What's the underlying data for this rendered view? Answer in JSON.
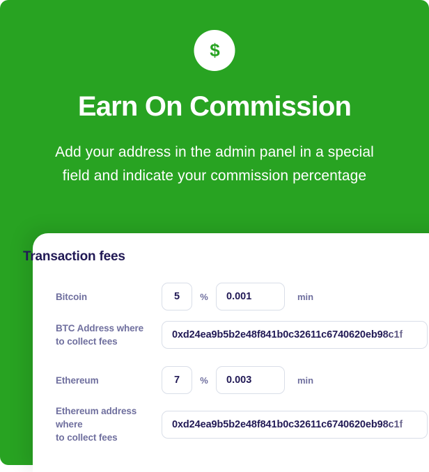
{
  "hero": {
    "icon": "dollar-circle-icon",
    "title": "Earn On Commission",
    "subtitle": "Add your address in the admin panel in a special field and indicate your commission percentage",
    "background_color": "#28A322",
    "text_color": "#FFFFFF"
  },
  "card": {
    "title": "Transaction fees",
    "title_color": "#211955",
    "label_color": "#6F6F9E",
    "border_color": "#D9DEE8",
    "fees": [
      {
        "label": "Bitcoin",
        "percent_value": "5",
        "percent_unit": "%",
        "min_value": "0.001",
        "min_unit": "min"
      },
      {
        "label": "Ethereum",
        "percent_value": "7",
        "percent_unit": "%",
        "min_value": "0.003",
        "min_unit": "min"
      }
    ],
    "addresses": [
      {
        "label_line1": "BTC Address where",
        "label_line2": "to collect fees",
        "value": "0xd24ea9b5b2e48f841b0c32611c6740620eb98c1f"
      },
      {
        "label_line1": "Ethereum address where",
        "label_line2": "to collect fees",
        "value": "0xd24ea9b5b2e48f841b0c32611c6740620eb98c1f"
      }
    ]
  }
}
